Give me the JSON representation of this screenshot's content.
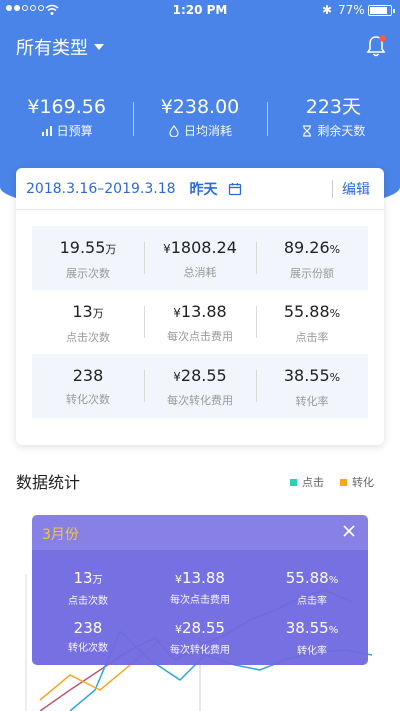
{
  "status_bar": {
    "time": "1:20 PM",
    "battery_pct": "77%",
    "battery_level": 0.77
  },
  "header": {
    "title": "所有类型"
  },
  "summary": [
    {
      "value": "¥169.56",
      "label": "日预算",
      "icon": "chart-icon"
    },
    {
      "value": "¥238.00",
      "label": "日均消耗",
      "icon": "drop-icon"
    },
    {
      "value": "223天",
      "label": "剩余天数",
      "icon": "hourglass-icon"
    }
  ],
  "card": {
    "date_range": "2018.3.16–2019.3.18",
    "day_label": "昨天",
    "edit_label": "编辑",
    "rows": [
      [
        {
          "num": "19.55",
          "unit": "万",
          "label": "展示次数"
        },
        {
          "cur": "¥",
          "num": "1808.24",
          "label": "总消耗"
        },
        {
          "num": "89.26",
          "unit": "%",
          "label": "展示份额"
        }
      ],
      [
        {
          "num": "13",
          "unit": "万",
          "label": "点击次数"
        },
        {
          "cur": "¥",
          "num": "13.88",
          "label": "每次点击费用"
        },
        {
          "num": "55.88",
          "unit": "%",
          "label": "点击率"
        }
      ],
      [
        {
          "num": "238",
          "label": "转化次数"
        },
        {
          "cur": "¥",
          "num": "28.55",
          "label": "每次转化费用"
        },
        {
          "num": "38.55",
          "unit": "%",
          "label": "转化率"
        }
      ]
    ]
  },
  "stats": {
    "title": "数据统计",
    "legend": [
      {
        "name": "点击",
        "color": "#2fd0b5"
      },
      {
        "name": "转化",
        "color": "#f5a623"
      }
    ]
  },
  "tooltip": {
    "month": "3月份",
    "rows": [
      [
        {
          "num": "13",
          "unit": "万",
          "label": "点击次数"
        },
        {
          "cur": "¥",
          "num": "13.88",
          "label": "每次点击费用"
        },
        {
          "num": "55.88",
          "unit": "%",
          "label": "点击率"
        }
      ],
      [
        {
          "num": "238",
          "label": "转化次数"
        },
        {
          "cur": "¥",
          "num": "28.55",
          "label": "每次转化费用"
        },
        {
          "num": "38.55",
          "unit": "%",
          "label": "转化率"
        }
      ]
    ]
  },
  "colors": {
    "header_bg": "#4a84e8",
    "accent": "#2d6ad8",
    "tooltip_bg": "#7068e2",
    "line_click": "#2fa8d8",
    "line_conversion": "#f5a623",
    "line_third": "#b45a7a",
    "bell_badge": "#ff5a3c"
  }
}
